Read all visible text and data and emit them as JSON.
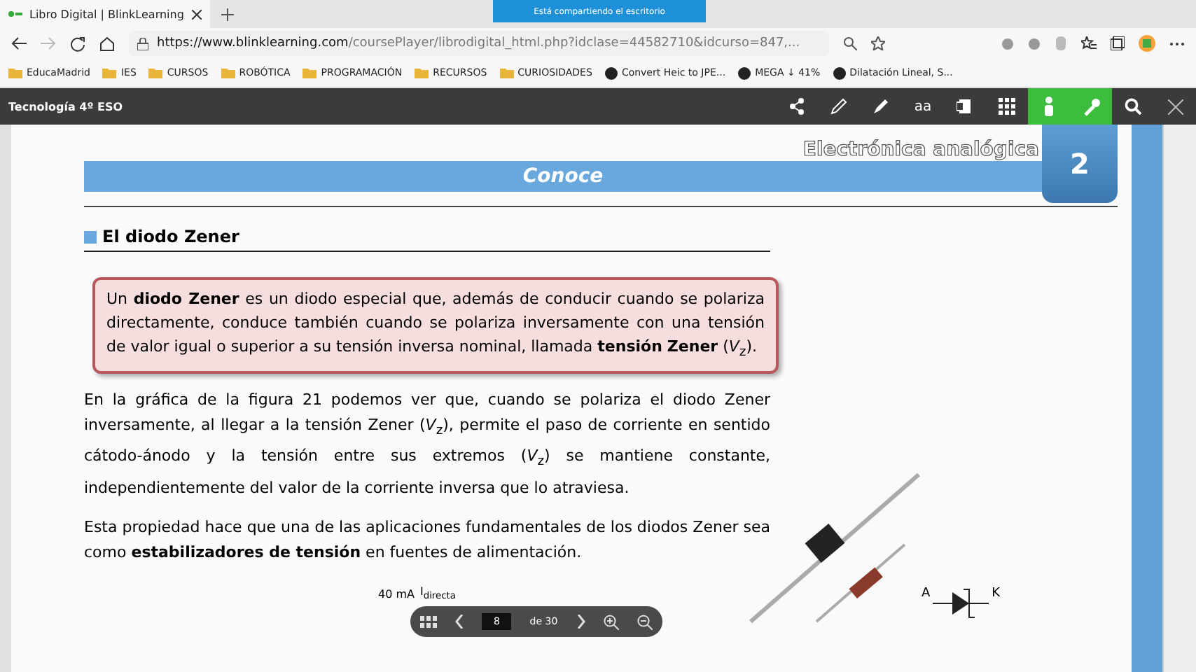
{
  "browser": {
    "tab": {
      "title": "Libro Digital | BlinkLearning"
    },
    "sharing_banner": "Está compartiendo el escritorio",
    "url": {
      "host": "https://www.blinklearning.com",
      "path": "/coursePlayer/librodigital_html.php?idclase=44582710&idcurso=847,..."
    },
    "bookmarks": [
      {
        "label": "EducaMadrid",
        "kind": "folder"
      },
      {
        "label": "IES",
        "kind": "folder"
      },
      {
        "label": "CURSOS",
        "kind": "folder"
      },
      {
        "label": "ROBÓTICA",
        "kind": "folder"
      },
      {
        "label": "PROGRAMACIÓN",
        "kind": "folder"
      },
      {
        "label": "RECURSOS",
        "kind": "folder"
      },
      {
        "label": "CURIOSIDADES",
        "kind": "folder"
      },
      {
        "label": "Convert Heic to JPE...",
        "kind": "site"
      },
      {
        "label": "MEGA ↓ 41%",
        "kind": "site"
      },
      {
        "label": "Dilatación Lineal, S...",
        "kind": "site"
      }
    ]
  },
  "app": {
    "title": "Tecnología 4º ESO",
    "tools": [
      {
        "kind": "share",
        "selected": false
      },
      {
        "kind": "pencil",
        "selected": false
      },
      {
        "kind": "marker",
        "selected": false
      },
      {
        "kind": "text",
        "label": "aa",
        "selected": false
      },
      {
        "kind": "notes",
        "selected": false
      },
      {
        "kind": "grid",
        "selected": false
      },
      {
        "kind": "person",
        "selected": true
      },
      {
        "kind": "wrench",
        "selected": true
      },
      {
        "kind": "search",
        "selected": false
      },
      {
        "kind": "close",
        "selected": false
      }
    ]
  },
  "page": {
    "unit_title": "Electrónica analógica",
    "unit_number": "2",
    "section_banner": "Conoce",
    "heading": "El diodo Zener",
    "definition": "Un **diodo Zener** es un diodo especial que, además de conducir cuando se polariza directamente, conduce también cuando se polariza inversamente con una tensión de valor igual o superior a su tensión inversa nominal, llamada **tensión** **Zener** (*V*$_{z}$).",
    "paragraphs": [
      "En la gráfica de la figura 21 podemos ver que, cuando se polariza el diodo Zener inversamente, al llegar a la tensión Zener (*V*$_{z}$), permite el paso de corriente en sentido cátodo-ánodo y la tensión entre sus extremos (*V*$_{z}$) se mantiene constante, independientemente del valor de la corriente inversa que lo atraviesa.",
      "Esta propiedad hace que una de las aplicaciones fundamentales de los diodos Zener sea como **estabilizadores de tensión** en fuentes de alimentación."
    ],
    "graph": {
      "y_label": "40 mA",
      "axis_label": "I$_{directa}$"
    },
    "symbol": {
      "anode": "A",
      "cathode": "K"
    }
  },
  "pager": {
    "page": "8",
    "total": "de 30"
  }
}
